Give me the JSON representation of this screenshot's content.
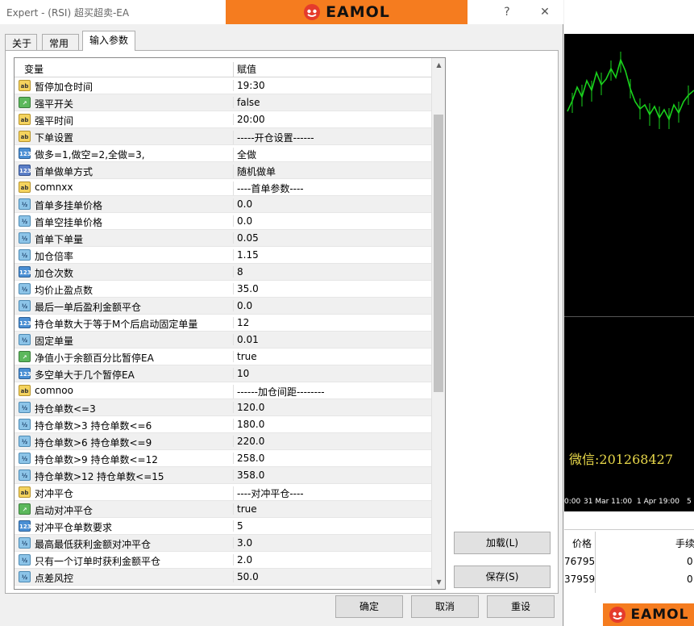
{
  "window": {
    "title": "Expert -   (RSI)  超买超卖-EA",
    "help_glyph": "?",
    "close_glyph": "✕"
  },
  "brand": {
    "name": "EAMOL"
  },
  "tabs": [
    {
      "label": "关于",
      "active": false
    },
    {
      "label": "常用",
      "active": false
    },
    {
      "label": "输入参数",
      "active": true
    }
  ],
  "grid": {
    "headers": {
      "variable": "变量",
      "value": "赋值"
    },
    "rows": [
      {
        "icon": "ab",
        "name": "暂停加仓时间",
        "value": "19:30"
      },
      {
        "icon": "bool",
        "name": "强平开关",
        "value": "false"
      },
      {
        "icon": "ab",
        "name": "强平时间",
        "value": "20:00"
      },
      {
        "icon": "ab",
        "name": "下单设置",
        "value": "-----开仓设置------"
      },
      {
        "icon": "123",
        "name": "做多=1,做空=2,全做=3,",
        "value": "全做"
      },
      {
        "icon": "enum",
        "name": "首单做单方式",
        "value": "随机做单"
      },
      {
        "icon": "ab",
        "name": "comnxx",
        "value": "----首单参数----"
      },
      {
        "icon": "float",
        "name": "首单多挂单价格",
        "value": "0.0"
      },
      {
        "icon": "float",
        "name": "首单空挂单价格",
        "value": "0.0"
      },
      {
        "icon": "float",
        "name": "首单下单量",
        "value": "0.05"
      },
      {
        "icon": "float",
        "name": "加仓倍率",
        "value": "1.15"
      },
      {
        "icon": "123",
        "name": "加仓次数",
        "value": "8"
      },
      {
        "icon": "float",
        "name": "均价止盈点数",
        "value": "35.0"
      },
      {
        "icon": "float",
        "name": "最后一单后盈利金额平仓",
        "value": "0.0"
      },
      {
        "icon": "123",
        "name": "持仓单数大于等于M个后启动固定单量",
        "value": "12"
      },
      {
        "icon": "float",
        "name": "固定单量",
        "value": "0.01"
      },
      {
        "icon": "bool",
        "name": "净值小于余额百分比暂停EA",
        "value": "true"
      },
      {
        "icon": "123",
        "name": "多空单大于几个暂停EA",
        "value": "10"
      },
      {
        "icon": "ab",
        "name": "comnoo",
        "value": "------加仓间距--------"
      },
      {
        "icon": "float",
        "name": "持仓单数<=3",
        "value": "120.0"
      },
      {
        "icon": "float",
        "name": "持仓单数>3    持仓单数<=6",
        "value": "180.0"
      },
      {
        "icon": "float",
        "name": "持仓单数>6    持仓单数<=9",
        "value": "220.0"
      },
      {
        "icon": "float",
        "name": "持仓单数>9    持仓单数<=12",
        "value": "258.0"
      },
      {
        "icon": "float",
        "name": "持仓单数>12  持仓单数<=15",
        "value": "358.0"
      },
      {
        "icon": "ab",
        "name": "对冲平仓",
        "value": "----对冲平仓----"
      },
      {
        "icon": "bool",
        "name": "启动对冲平仓",
        "value": "true"
      },
      {
        "icon": "123",
        "name": "对冲平仓单数要求",
        "value": "5"
      },
      {
        "icon": "float",
        "name": "最高最低获利金额对冲平仓",
        "value": "3.0"
      },
      {
        "icon": "float",
        "name": "只有一个订单时获利金额平仓",
        "value": "2.0"
      },
      {
        "icon": "float",
        "name": "点差风控",
        "value": "50.0"
      }
    ]
  },
  "icons": {
    "ab": "ab",
    "bool": "↗",
    "123": "123",
    "enum": "123",
    "float": "½"
  },
  "buttons": {
    "load": "加载(L)",
    "save": "保存(S)",
    "ok": "确定",
    "cancel": "取消",
    "reset": "重设"
  },
  "background_chart": {
    "watermark": "微信:201268427",
    "time_labels": [
      "0:00",
      "31 Mar 11:00",
      "1 Apr 19:00",
      "5"
    ],
    "table_header": {
      "price": "价格",
      "fee": "手续"
    },
    "table_rows": [
      {
        "price": "76795",
        "fee": "0"
      },
      {
        "price": "37959",
        "fee": "0"
      }
    ]
  }
}
